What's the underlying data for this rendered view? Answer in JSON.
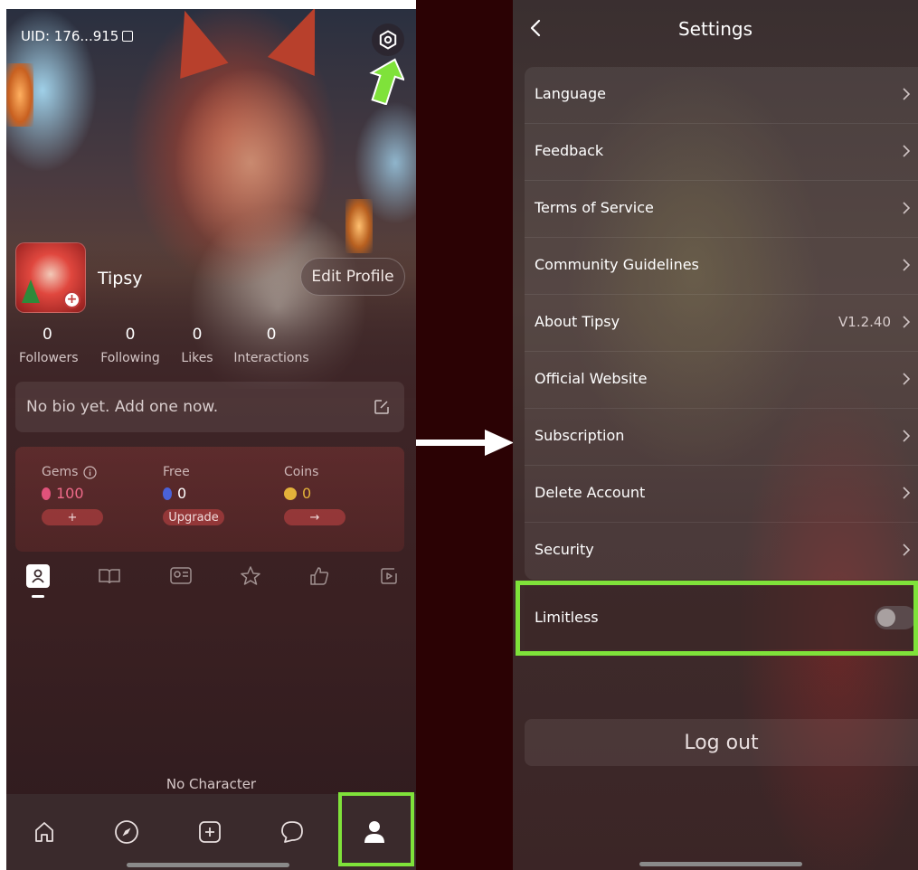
{
  "profile": {
    "uid": "UID: 176...915",
    "name": "Tipsy",
    "edit_label": "Edit Profile",
    "stats": [
      {
        "value": "0",
        "label": "Followers"
      },
      {
        "value": "0",
        "label": "Following"
      },
      {
        "value": "0",
        "label": "Likes"
      },
      {
        "value": "0",
        "label": "Interactions"
      }
    ],
    "bio_placeholder": "No bio yet. Add one now."
  },
  "wallet": {
    "gems": {
      "label": "Gems",
      "value": "100",
      "button": "+"
    },
    "free": {
      "label": "Free",
      "value": "0",
      "button": "Upgrade"
    },
    "coins": {
      "label": "Coins",
      "value": "0",
      "button": "→"
    }
  },
  "content": {
    "empty_label": "No Character"
  },
  "settings": {
    "title": "Settings",
    "items": [
      {
        "label": "Language",
        "value": ""
      },
      {
        "label": "Feedback",
        "value": ""
      },
      {
        "label": "Terms of Service",
        "value": ""
      },
      {
        "label": "Community Guidelines",
        "value": ""
      },
      {
        "label": "About Tipsy",
        "value": "V1.2.40"
      },
      {
        "label": "Official Website",
        "value": ""
      },
      {
        "label": "Subscription",
        "value": ""
      },
      {
        "label": "Delete Account",
        "value": ""
      },
      {
        "label": "Security",
        "value": ""
      }
    ],
    "limitless": {
      "label": "Limitless",
      "enabled": false
    },
    "logout_label": "Log out"
  },
  "colors": {
    "highlight": "#7fe23a",
    "gem_pink": "#e0527a",
    "free_blue": "#4a62d8",
    "coin_gold": "#e3b23a",
    "divider_bg": "#2b0204"
  }
}
